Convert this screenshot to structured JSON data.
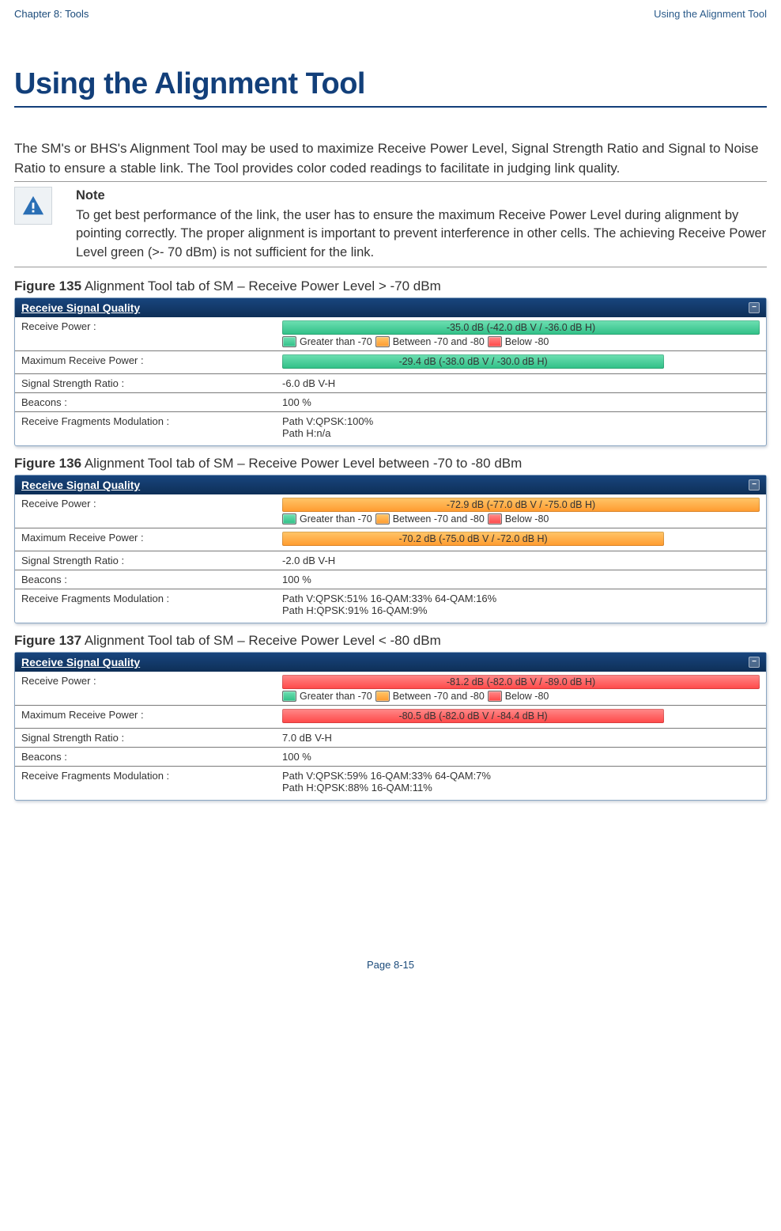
{
  "header": {
    "left": "Chapter 8:  Tools",
    "right": "Using the Alignment Tool"
  },
  "main_title": "Using the Alignment Tool",
  "intro": "The SM's or BHS's Alignment Tool may be used to maximize Receive Power Level, Signal Strength Ratio and Signal to Noise Ratio to ensure a stable link. The Tool provides color coded readings to facilitate in judging link quality.",
  "note": {
    "label": "Note",
    "body": "To get best performance of the link, the user has to ensure the maximum Receive Power Level during alignment by pointing correctly. The proper alignment is important to prevent interference in other cells. The achieving Receive Power Level green (>- 70 dBm) is not sufficient for the link."
  },
  "legend": {
    "gt": "Greater than -70",
    "bt": "Between -70 and -80",
    "lt": "Below -80"
  },
  "panel_title": "Receive Signal Quality",
  "row_labels": {
    "rp": "Receive Power :",
    "mrp": "Maximum Receive Power :",
    "ssr": "Signal Strength Ratio :",
    "beacons": "Beacons :",
    "rfm": "Receive Fragments Modulation :"
  },
  "figures": [
    {
      "num": "Figure 135",
      "caption": "Alignment Tool tab of SM – Receive Power Level > -70 dBm",
      "rp_bar_color": "green",
      "rp_text": "-35.0 dB (-42.0 dB V / -36.0 dB H)",
      "mrp_bar_color": "green",
      "mrp_text": "-29.4 dB (-38.0 dB V / -30.0 dB H)",
      "ssr": "-6.0 dB V-H",
      "beacons": "100 %",
      "rfm1": "Path V:QPSK:100%",
      "rfm2": "Path H:n/a"
    },
    {
      "num": "Figure 136",
      "caption": "Alignment Tool tab of SM – Receive Power Level between -70 to -80 dBm",
      "rp_bar_color": "orange",
      "rp_text": "-72.9 dB (-77.0 dB V / -75.0 dB H)",
      "mrp_bar_color": "orange",
      "mrp_text": "-70.2 dB (-75.0 dB V / -72.0 dB H)",
      "ssr": "-2.0 dB V-H",
      "beacons": "100 %",
      "rfm1": "Path V:QPSK:51% 16-QAM:33% 64-QAM:16%",
      "rfm2": "Path H:QPSK:91% 16-QAM:9%"
    },
    {
      "num": "Figure 137",
      "caption": "Alignment Tool tab of SM – Receive Power Level < -80 dBm",
      "rp_bar_color": "red",
      "rp_text": "-81.2 dB (-82.0 dB V / -89.0 dB H)",
      "mrp_bar_color": "red",
      "mrp_text": "-80.5 dB (-82.0 dB V / -84.4 dB H)",
      "ssr": "7.0 dB V-H",
      "beacons": "100 %",
      "rfm1": "Path V:QPSK:59% 16-QAM:33% 64-QAM:7%",
      "rfm2": "Path H:QPSK:88% 16-QAM:11%"
    }
  ],
  "footer": "Page 8-15"
}
